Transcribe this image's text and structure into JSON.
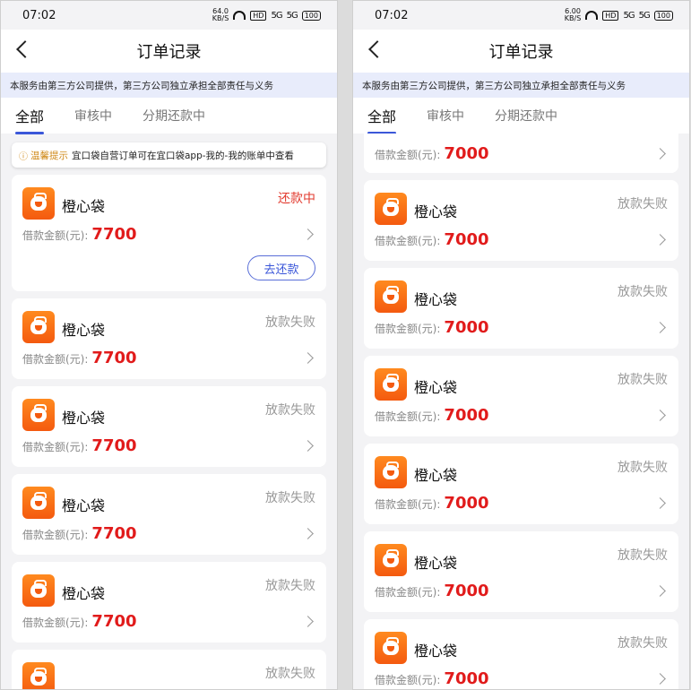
{
  "left": {
    "time": "07:02",
    "net_speed": "64.0",
    "net_unit": "KB/S",
    "hd": "HD",
    "signal1": "5G",
    "signal2": "5G",
    "battery": "100",
    "title": "订单记录",
    "notice": "本服务由第三方公司提供，第三方公司独立承担全部责任与义务",
    "tabs": [
      "全部",
      "审核中",
      "分期还款中"
    ],
    "tip_label": "温馨提示",
    "tip_text": "宜口袋自营订单可在宜口袋app-我的-我的账单中查看",
    "amount_label": "借款金额(元):",
    "repay_label": "去还款",
    "orders": [
      {
        "name": "橙心袋",
        "status": "还款中",
        "amount": "7700"
      },
      {
        "name": "橙心袋",
        "status": "放款失败",
        "amount": "7700"
      },
      {
        "name": "橙心袋",
        "status": "放款失败",
        "amount": "7700"
      },
      {
        "name": "橙心袋",
        "status": "放款失败",
        "amount": "7700"
      },
      {
        "name": "橙心袋",
        "status": "放款失败",
        "amount": "7700"
      },
      {
        "name": "",
        "status": "放款失败",
        "amount": ""
      }
    ]
  },
  "right": {
    "time": "07:02",
    "net_speed": "6.00",
    "net_unit": "KB/S",
    "hd": "HD",
    "signal1": "5G",
    "signal2": "5G",
    "battery": "100",
    "title": "订单记录",
    "notice": "本服务由第三方公司提供，第三方公司独立承担全部责任与义务",
    "tabs": [
      "全部",
      "审核中",
      "分期还款中"
    ],
    "amount_label": "借款金额(元):",
    "first_amount": "7000",
    "orders": [
      {
        "name": "橙心袋",
        "status": "放款失败",
        "amount": "7000"
      },
      {
        "name": "橙心袋",
        "status": "放款失败",
        "amount": "7000"
      },
      {
        "name": "橙心袋",
        "status": "放款失败",
        "amount": "7000"
      },
      {
        "name": "橙心袋",
        "status": "放款失败",
        "amount": "7000"
      },
      {
        "name": "橙心袋",
        "status": "放款失败",
        "amount": "7000"
      },
      {
        "name": "橙心袋",
        "status": "放款失败",
        "amount": "7000"
      }
    ]
  },
  "colors": {
    "accent": "#3b57d9",
    "amount": "#e11b1b",
    "repaying": "#e23a2e",
    "logo": "#f45a0f"
  }
}
